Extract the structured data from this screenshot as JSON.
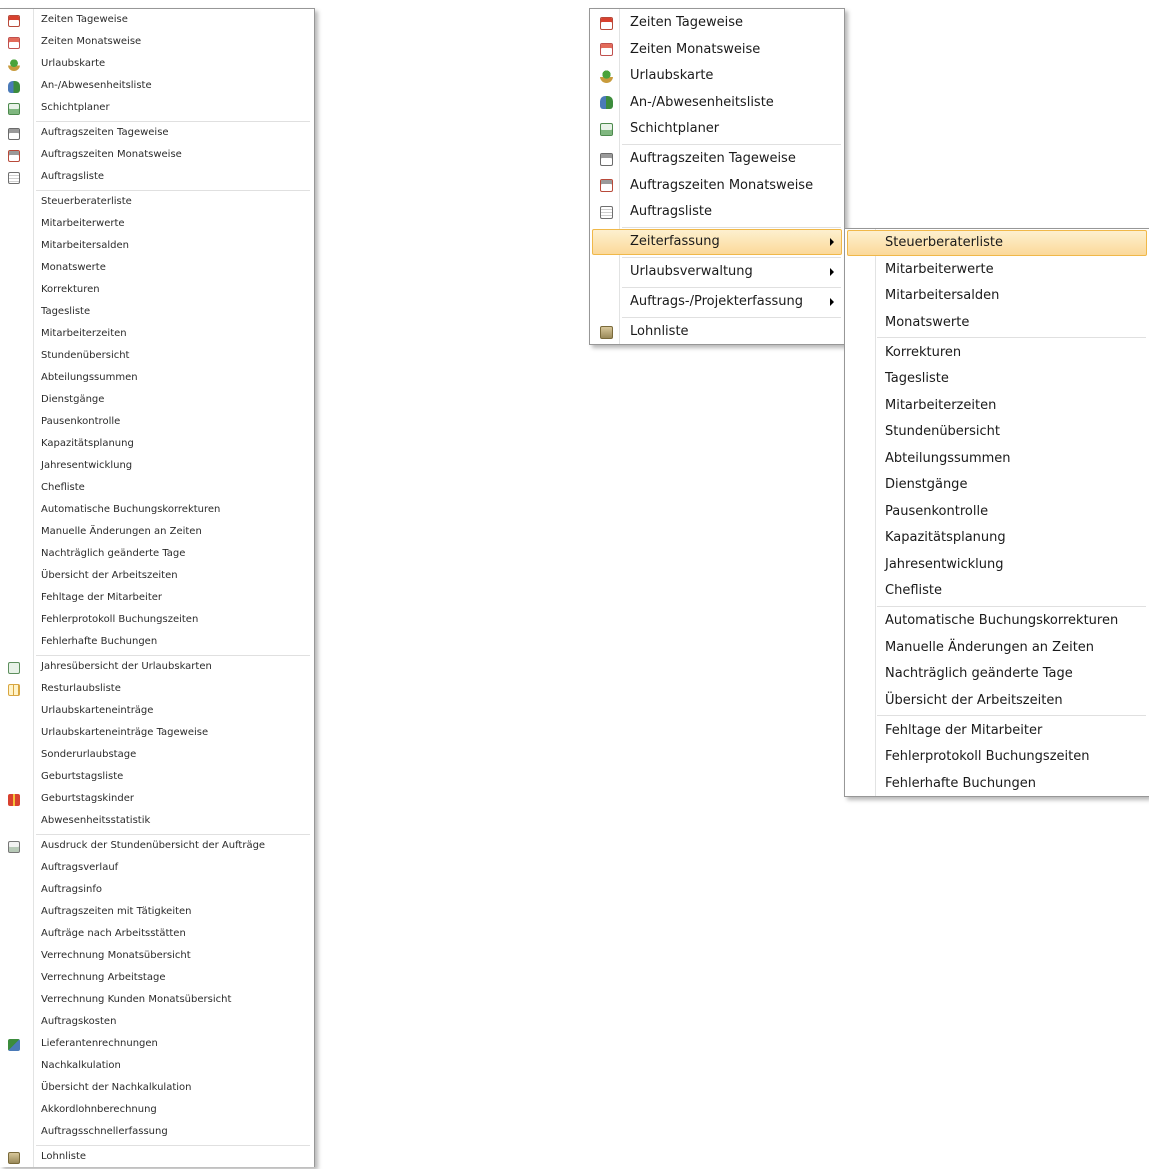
{
  "left_menu": {
    "groups": [
      [
        {
          "label": "Zeiten Tageweise",
          "icon": "day-calendar-icon"
        },
        {
          "label": "Zeiten Monatsweise",
          "icon": "month-calendar-icon"
        },
        {
          "label": "Urlaubskarte",
          "icon": "vacation-tree-icon"
        },
        {
          "label": "An-/Abwesenheitsliste",
          "icon": "presence-list-icon"
        },
        {
          "label": "Schichtplaner",
          "icon": "shift-planner-icon"
        }
      ],
      [
        {
          "label": "Auftragszeiten Tageweise",
          "icon": "order-day-icon"
        },
        {
          "label": "Auftragszeiten Monatsweise",
          "icon": "order-month-icon"
        },
        {
          "label": "Auftragsliste",
          "icon": "order-list-icon"
        }
      ],
      [
        {
          "label": "Steuerberaterliste",
          "icon": ""
        },
        {
          "label": "Mitarbeiterwerte",
          "icon": ""
        },
        {
          "label": "Mitarbeitersalden",
          "icon": ""
        },
        {
          "label": "Monatswerte",
          "icon": ""
        },
        {
          "label": "Korrekturen",
          "icon": ""
        },
        {
          "label": "Tagesliste",
          "icon": ""
        },
        {
          "label": "Mitarbeiterzeiten",
          "icon": ""
        },
        {
          "label": "Stundenübersicht",
          "icon": ""
        },
        {
          "label": "Abteilungssummen",
          "icon": ""
        },
        {
          "label": "Dienstgänge",
          "icon": ""
        },
        {
          "label": "Pausenkontrolle",
          "icon": ""
        },
        {
          "label": "Kapazitätsplanung",
          "icon": ""
        },
        {
          "label": "Jahresentwicklung",
          "icon": ""
        },
        {
          "label": "Chefliste",
          "icon": ""
        },
        {
          "label": "Automatische Buchungskorrekturen",
          "icon": ""
        },
        {
          "label": "Manuelle Änderungen an Zeiten",
          "icon": ""
        },
        {
          "label": "Nachträglich geänderte Tage",
          "icon": ""
        },
        {
          "label": "Übersicht der Arbeitszeiten",
          "icon": ""
        },
        {
          "label": "Fehltage der Mitarbeiter",
          "icon": ""
        },
        {
          "label": "Fehlerprotokoll Buchungszeiten",
          "icon": ""
        },
        {
          "label": "Fehlerhafte Buchungen",
          "icon": ""
        }
      ],
      [
        {
          "label": "Jahresübersicht der Urlaubskarten",
          "icon": "year-overview-icon"
        },
        {
          "label": "Resturlaubsliste",
          "icon": "grid-table-icon"
        },
        {
          "label": "Urlaubskarteneinträge",
          "icon": ""
        },
        {
          "label": "Urlaubskarteneinträge Tageweise",
          "icon": ""
        },
        {
          "label": "Sonderurlaubstage",
          "icon": ""
        },
        {
          "label": "Geburtstagsliste",
          "icon": ""
        },
        {
          "label": "Geburtstagskinder",
          "icon": "gift-icon"
        },
        {
          "label": "Abwesenheitsstatistik",
          "icon": ""
        }
      ],
      [
        {
          "label": "Ausdruck der Stundenübersicht der Aufträge",
          "icon": "print-report-icon"
        },
        {
          "label": "Auftragsverlauf",
          "icon": ""
        },
        {
          "label": "Auftragsinfo",
          "icon": ""
        },
        {
          "label": "Auftragszeiten mit Tätigkeiten",
          "icon": ""
        },
        {
          "label": "Aufträge nach Arbeitsstätten",
          "icon": ""
        },
        {
          "label": "Verrechnung Monatsübersicht",
          "icon": ""
        },
        {
          "label": "Verrechnung Arbeitstage",
          "icon": ""
        },
        {
          "label": "Verrechnung Kunden Monatsübersicht",
          "icon": ""
        },
        {
          "label": "Auftragskosten",
          "icon": ""
        },
        {
          "label": "Lieferantenrechnungen",
          "icon": "supplier-invoice-icon"
        },
        {
          "label": "Nachkalkulation",
          "icon": ""
        },
        {
          "label": "Übersicht der Nachkalkulation",
          "icon": ""
        },
        {
          "label": "Akkordlohnberechnung",
          "icon": ""
        },
        {
          "label": "Auftragsschnellerfassung",
          "icon": ""
        }
      ],
      [
        {
          "label": "Lohnliste",
          "icon": "payroll-icon"
        }
      ]
    ]
  },
  "main_menu": {
    "groups": [
      [
        {
          "label": "Zeiten Tageweise",
          "icon": "day-calendar-icon"
        },
        {
          "label": "Zeiten Monatsweise",
          "icon": "month-calendar-icon"
        },
        {
          "label": "Urlaubskarte",
          "icon": "vacation-tree-icon"
        },
        {
          "label": "An-/Abwesenheitsliste",
          "icon": "presence-list-icon"
        },
        {
          "label": "Schichtplaner",
          "icon": "shift-planner-icon"
        }
      ],
      [
        {
          "label": "Auftragszeiten Tageweise",
          "icon": "order-day-icon"
        },
        {
          "label": "Auftragszeiten Monatsweise",
          "icon": "order-month-icon"
        },
        {
          "label": "Auftragsliste",
          "icon": "order-list-icon"
        }
      ],
      [
        {
          "label": "Zeiterfassung",
          "icon": "",
          "submenu": true,
          "highlighted": true
        }
      ],
      [
        {
          "label": "Urlaubsverwaltung",
          "icon": "",
          "submenu": true
        }
      ],
      [
        {
          "label": "Auftrags-/Projekterfassung",
          "icon": "",
          "submenu": true
        }
      ],
      [
        {
          "label": "Lohnliste",
          "icon": "payroll-icon"
        }
      ]
    ]
  },
  "submenu": {
    "groups": [
      [
        {
          "label": "Steuerberaterliste",
          "highlighted": true
        },
        {
          "label": "Mitarbeiterwerte"
        },
        {
          "label": "Mitarbeitersalden"
        },
        {
          "label": "Monatswerte"
        }
      ],
      [
        {
          "label": "Korrekturen"
        },
        {
          "label": "Tagesliste"
        },
        {
          "label": "Mitarbeiterzeiten"
        },
        {
          "label": "Stundenübersicht"
        },
        {
          "label": "Abteilungssummen"
        },
        {
          "label": "Dienstgänge"
        },
        {
          "label": "Pausenkontrolle"
        },
        {
          "label": "Kapazitätsplanung"
        },
        {
          "label": "Jahresentwicklung"
        },
        {
          "label": "Chefliste"
        }
      ],
      [
        {
          "label": "Automatische Buchungskorrekturen"
        },
        {
          "label": "Manuelle Änderungen an Zeiten"
        },
        {
          "label": "Nachträglich geänderte Tage"
        },
        {
          "label": "Übersicht der Arbeitszeiten"
        }
      ],
      [
        {
          "label": "Fehltage der Mitarbeiter"
        },
        {
          "label": "Fehlerprotokoll Buchungszeiten"
        },
        {
          "label": "Fehlerhafte Buchungen"
        }
      ]
    ]
  },
  "colors": {
    "highlight_top": "#fdf0cf",
    "highlight_bottom": "#fbd99a",
    "highlight_border": "#f0b849",
    "menu_border": "#979797",
    "separator": "#e0e0e0"
  }
}
